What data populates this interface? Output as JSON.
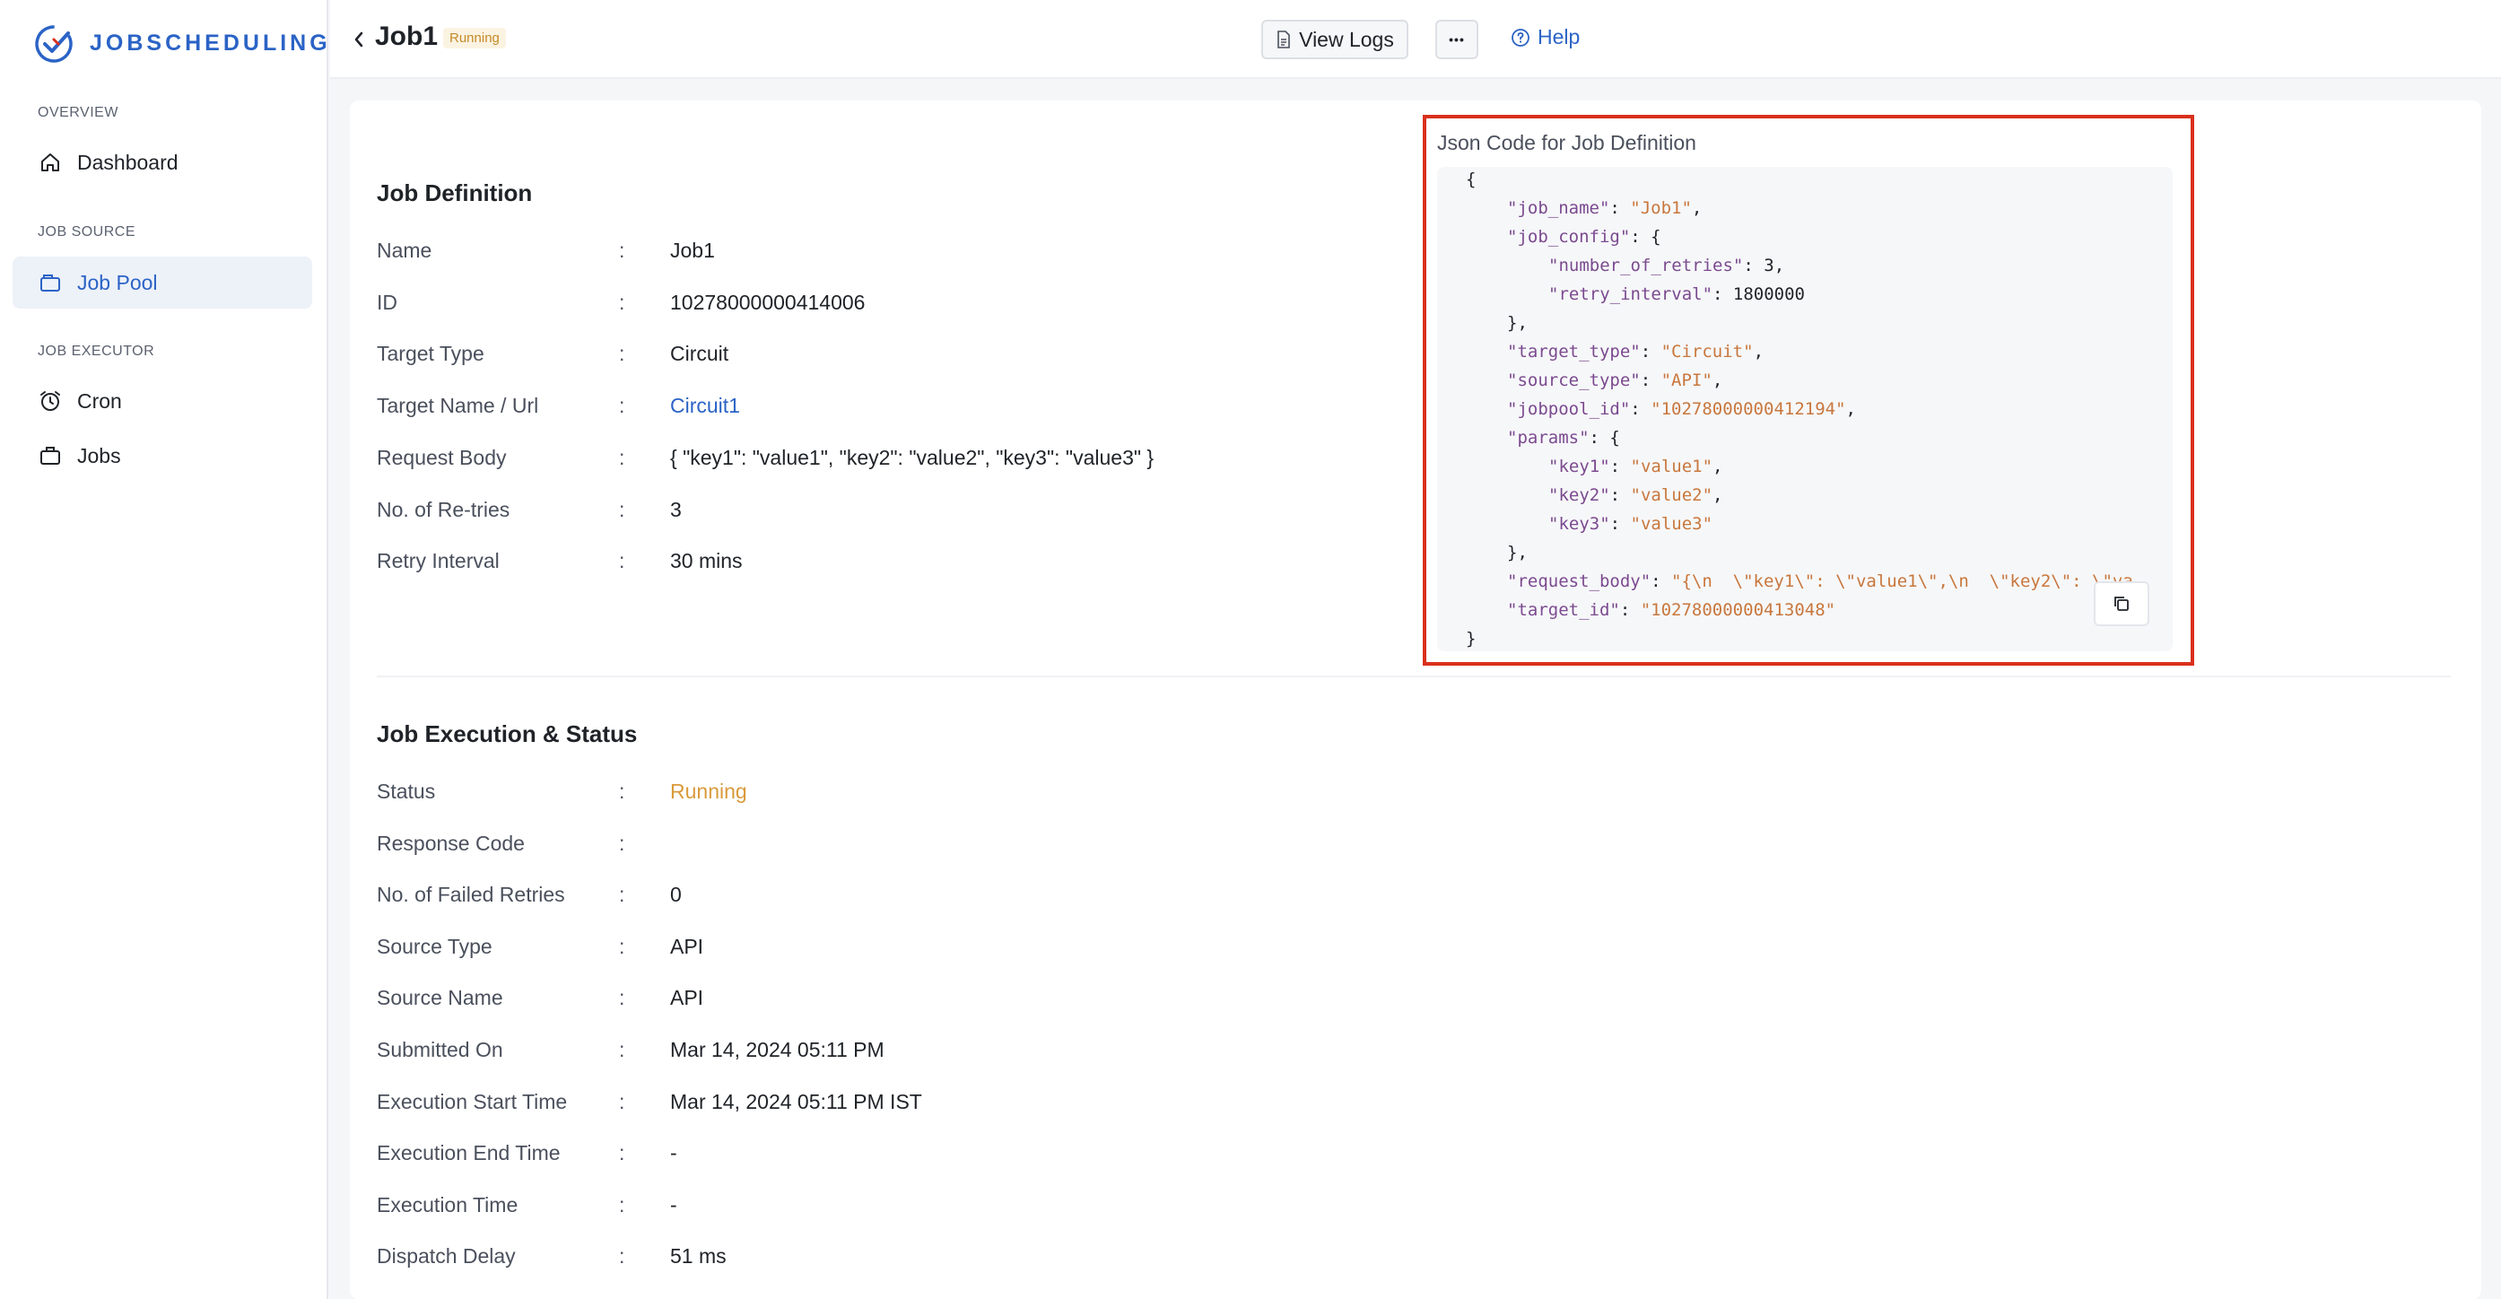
{
  "app": {
    "brand": "JOBSCHEDULING"
  },
  "sidebar": {
    "sections": [
      {
        "title": "OVERVIEW",
        "items": [
          {
            "label": "Dashboard",
            "icon": "home-icon"
          }
        ]
      },
      {
        "title": "JOB SOURCE",
        "items": [
          {
            "label": "Job Pool",
            "icon": "folder-icon",
            "active": true
          }
        ]
      },
      {
        "title": "JOB EXECUTOR",
        "items": [
          {
            "label": "Cron",
            "icon": "alarm-clock-icon"
          },
          {
            "label": "Jobs",
            "icon": "briefcase-icon"
          }
        ]
      }
    ]
  },
  "header": {
    "title": "Job1",
    "status_badge": "Running",
    "view_logs_label": "View Logs",
    "more_label": "•••",
    "help_label": "Help"
  },
  "job_definition": {
    "title": "Job Definition",
    "rows": [
      {
        "label": "Name",
        "value": "Job1"
      },
      {
        "label": "ID",
        "value": "10278000000414006"
      },
      {
        "label": "Target Type",
        "value": "Circuit"
      },
      {
        "label": "Target Name / Url",
        "value": "Circuit1"
      },
      {
        "label": "Request Body",
        "value": "{ \"key1\": \"value1\", \"key2\": \"value2\", \"key3\": \"value3\" }"
      },
      {
        "label": "No. of Re-tries",
        "value": "3"
      },
      {
        "label": "Retry Interval",
        "value": "30 mins"
      }
    ]
  },
  "json_panel": {
    "title": "Json Code for Job Definition",
    "lines": [
      {
        "indent": 0,
        "tokens": [
          {
            "t": "p",
            "v": "{"
          }
        ]
      },
      {
        "indent": 1,
        "tokens": [
          {
            "t": "k",
            "v": "\"job_name\""
          },
          {
            "t": "p",
            "v": ": "
          },
          {
            "t": "s",
            "v": "\"Job1\""
          },
          {
            "t": "p",
            "v": ","
          }
        ]
      },
      {
        "indent": 1,
        "tokens": [
          {
            "t": "k",
            "v": "\"job_config\""
          },
          {
            "t": "p",
            "v": ": {"
          }
        ]
      },
      {
        "indent": 2,
        "tokens": [
          {
            "t": "k",
            "v": "\"number_of_retries\""
          },
          {
            "t": "p",
            "v": ": "
          },
          {
            "t": "n",
            "v": "3"
          },
          {
            "t": "p",
            "v": ","
          }
        ]
      },
      {
        "indent": 2,
        "tokens": [
          {
            "t": "k",
            "v": "\"retry_interval\""
          },
          {
            "t": "p",
            "v": ": "
          },
          {
            "t": "n",
            "v": "1800000"
          }
        ]
      },
      {
        "indent": 1,
        "tokens": [
          {
            "t": "p",
            "v": "},"
          }
        ]
      },
      {
        "indent": 1,
        "tokens": [
          {
            "t": "k",
            "v": "\"target_type\""
          },
          {
            "t": "p",
            "v": ": "
          },
          {
            "t": "s",
            "v": "\"Circuit\""
          },
          {
            "t": "p",
            "v": ","
          }
        ]
      },
      {
        "indent": 1,
        "tokens": [
          {
            "t": "k",
            "v": "\"source_type\""
          },
          {
            "t": "p",
            "v": ": "
          },
          {
            "t": "s",
            "v": "\"API\""
          },
          {
            "t": "p",
            "v": ","
          }
        ]
      },
      {
        "indent": 1,
        "tokens": [
          {
            "t": "k",
            "v": "\"jobpool_id\""
          },
          {
            "t": "p",
            "v": ": "
          },
          {
            "t": "s",
            "v": "\"10278000000412194\""
          },
          {
            "t": "p",
            "v": ","
          }
        ]
      },
      {
        "indent": 1,
        "tokens": [
          {
            "t": "k",
            "v": "\"params\""
          },
          {
            "t": "p",
            "v": ": {"
          }
        ]
      },
      {
        "indent": 2,
        "tokens": [
          {
            "t": "k",
            "v": "\"key1\""
          },
          {
            "t": "p",
            "v": ": "
          },
          {
            "t": "s",
            "v": "\"value1\""
          },
          {
            "t": "p",
            "v": ","
          }
        ]
      },
      {
        "indent": 2,
        "tokens": [
          {
            "t": "k",
            "v": "\"key2\""
          },
          {
            "t": "p",
            "v": ": "
          },
          {
            "t": "s",
            "v": "\"value2\""
          },
          {
            "t": "p",
            "v": ","
          }
        ]
      },
      {
        "indent": 2,
        "tokens": [
          {
            "t": "k",
            "v": "\"key3\""
          },
          {
            "t": "p",
            "v": ": "
          },
          {
            "t": "s",
            "v": "\"value3\""
          }
        ]
      },
      {
        "indent": 1,
        "tokens": [
          {
            "t": "p",
            "v": "},"
          }
        ]
      },
      {
        "indent": 1,
        "tokens": [
          {
            "t": "k",
            "v": "\"request_body\""
          },
          {
            "t": "p",
            "v": ": "
          },
          {
            "t": "s",
            "v": "\"{\\n  \\\"key1\\\": \\\"value1\\\",\\n  \\\"key2\\\": \\\"va"
          }
        ]
      },
      {
        "indent": 1,
        "tokens": [
          {
            "t": "k",
            "v": "\"target_id\""
          },
          {
            "t": "p",
            "v": ": "
          },
          {
            "t": "s",
            "v": "\"10278000000413048\""
          }
        ]
      },
      {
        "indent": 0,
        "tokens": [
          {
            "t": "p",
            "v": "}"
          }
        ]
      }
    ]
  },
  "job_execution": {
    "title": "Job Execution & Status",
    "rows": [
      {
        "label": "Status",
        "value": "Running",
        "style": "warn"
      },
      {
        "label": "Response Code",
        "value": ""
      },
      {
        "label": "No. of Failed Retries",
        "value": "0"
      },
      {
        "label": "Source Type",
        "value": "API"
      },
      {
        "label": "Source Name",
        "value": "API"
      },
      {
        "label": "Submitted On",
        "value": "Mar 14, 2024 05:11 PM"
      },
      {
        "label": "Execution Start Time",
        "value": "Mar 14, 2024 05:11 PM IST"
      },
      {
        "label": "Execution End Time",
        "value": "-"
      },
      {
        "label": "Execution Time",
        "value": "-"
      },
      {
        "label": "Dispatch Delay",
        "value": "51 ms"
      }
    ]
  },
  "colors": {
    "accent": "#2b63c6",
    "warning": "#d99a3a",
    "highlight_border": "#d9301c",
    "json_key": "#7b4a8f",
    "json_string": "#c8773d"
  }
}
